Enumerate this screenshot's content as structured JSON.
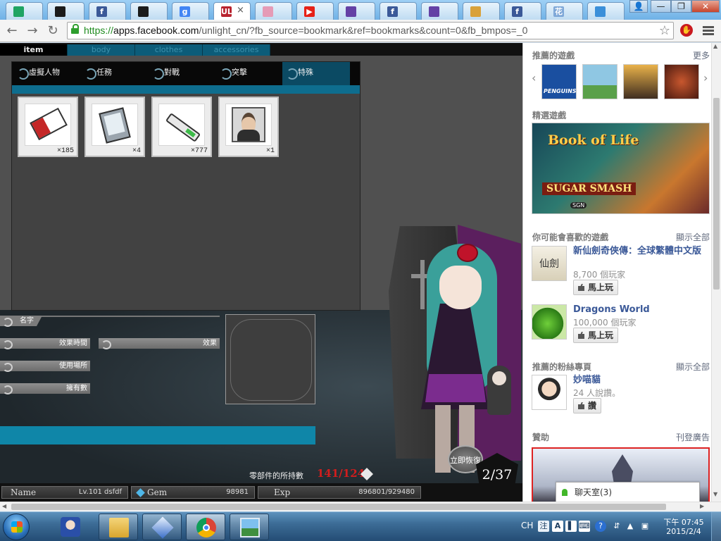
{
  "browser": {
    "tabs": [
      {
        "icon": "google-drive-icon",
        "color": "#1fa463"
      },
      {
        "icon": "unlight-icon",
        "color": "#1b1b1b"
      },
      {
        "icon": "facebook-icon",
        "color": "#3b5998"
      },
      {
        "icon": "unlight-icon",
        "color": "#1b1b1b"
      },
      {
        "icon": "google-icon",
        "color": "#4285f4"
      },
      {
        "icon": "game-icon",
        "color": "#b8232f",
        "active": true
      },
      {
        "icon": "anime-icon",
        "color": "#e59bb6"
      },
      {
        "icon": "youtube-icon",
        "color": "#e62117"
      },
      {
        "icon": "twitch-icon",
        "color": "#6441a5"
      },
      {
        "icon": "facebook-icon",
        "color": "#3b5998"
      },
      {
        "icon": "twitch-icon",
        "color": "#6441a5"
      },
      {
        "icon": "boat-icon",
        "color": "#d9a13a"
      },
      {
        "icon": "facebook-icon",
        "color": "#3b5998"
      },
      {
        "icon": "flower-icon",
        "color": "#7fa8d8"
      },
      {
        "icon": "camera-icon",
        "color": "#3b8fd9"
      }
    ],
    "tab_glyphs": [
      "",
      "",
      "f",
      "",
      "g",
      "UL",
      "",
      "▶",
      "",
      "f",
      "",
      "",
      "f",
      "花",
      ""
    ],
    "url_scheme": "https://",
    "url_host": "apps.facebook.com",
    "url_path": "/unlight_cn/?fb_source=bookmark&ref=bookmarks&count=0&fb_bmpos=_0",
    "tab_close": "×",
    "win_min": "—",
    "win_max": "❐",
    "win_close": "✕",
    "win_user": "👤"
  },
  "game": {
    "top_tabs": [
      "item",
      "body",
      "clothes",
      "accessories"
    ],
    "categories": [
      "虛擬人物",
      "任務",
      "對戰",
      "突擊",
      "特殊"
    ],
    "active_category": "特殊",
    "items": [
      {
        "name": "ticket",
        "count": "×185"
      },
      {
        "name": "card",
        "count": "×4"
      },
      {
        "name": "stick",
        "count": "×777"
      },
      {
        "name": "portrait",
        "count": "×1"
      }
    ],
    "labels": {
      "name": "名字",
      "effect_time": "效果時間",
      "effect": "效果",
      "use_place": "使用場所",
      "owned": "擁有數"
    },
    "parts_label": "零部件的所持數",
    "parts_value": "141/124",
    "recover_label": "立即恢復",
    "counter": "2/37",
    "status": {
      "name_label": "Name",
      "name_value": "Lv.101 dsfdf",
      "gem_label": "Gem",
      "gem_value": "98981",
      "exp_label": "Exp",
      "exp_value": "896801/929480"
    }
  },
  "sidebar": {
    "recommended_title": "推薦的遊戲",
    "recommended_more": "更多",
    "tiles": [
      {
        "name": "penguins",
        "label": "PENGUINS",
        "color": "#1a4fa0"
      },
      {
        "name": "runner",
        "label": "",
        "color": "#8fc7e3"
      },
      {
        "name": "racing",
        "label": "",
        "color": "#3f2d20"
      },
      {
        "name": "dino",
        "label": "",
        "color": "#7a2e1c"
      }
    ],
    "featured_title": "精選遊戲",
    "featured_book": "Book of Life",
    "featured_sub": "SUGAR SMASH",
    "featured_badge": "SGN",
    "might_like_title": "你可能會喜歡的遊戲",
    "might_like_more": "顯示全部",
    "games": [
      {
        "title": "新仙劍奇俠傳：全球繁體中文版",
        "players": "8,700 個玩家",
        "button": "馬上玩",
        "thumb": "仙劍"
      },
      {
        "title": "Dragons World",
        "players": "100,000 個玩家",
        "button": "馬上玩",
        "thumb": ""
      }
    ],
    "fanpage_title": "推薦的粉絲專頁",
    "fanpage_more": "顯示全部",
    "fanpage": {
      "title": "妙喵貓",
      "meta": "24 人說讚。",
      "button": "讚"
    },
    "ads_title": "贊助",
    "ads_more": "刊登廣告",
    "chat_label": "聊天室(3)",
    "arrow_left": "‹",
    "arrow_right": "›"
  },
  "taskbar": {
    "lang": "CH",
    "ime": "注",
    "clock_time": "下午 07:45",
    "clock_date": "2015/2/4"
  },
  "colors": {
    "accent_teal": "#0f86a8",
    "fb_blue": "#3b5998",
    "parts_red": "#d21d1d"
  }
}
